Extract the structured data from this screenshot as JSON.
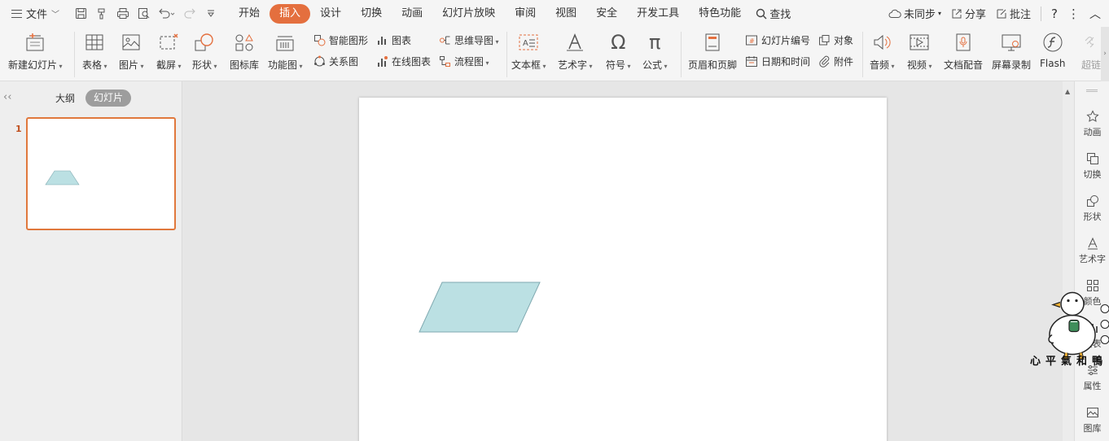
{
  "menubar": {
    "file_label": "文件",
    "tabs": [
      "开始",
      "插入",
      "设计",
      "切换",
      "动画",
      "幻灯片放映",
      "审阅",
      "视图",
      "安全",
      "开发工具",
      "特色功能"
    ],
    "active_tab": "插入",
    "search_label": "查找",
    "sync_label": "未同步",
    "share_label": "分享",
    "comment_label": "批注"
  },
  "ribbon": {
    "new_slide": "新建幻灯片",
    "table": "表格",
    "picture": "图片",
    "screenshot": "截屏",
    "shape": "形状",
    "icon_lib": "图标库",
    "function_chart": "功能图",
    "smart_shape": "智能图形",
    "relation": "关系图",
    "chart": "图表",
    "online_chart": "在线图表",
    "mindmap": "思维导图",
    "flowchart": "流程图",
    "textbox": "文本框",
    "wordart": "艺术字",
    "symbol": "符号",
    "formula": "公式",
    "header_footer": "页眉和页脚",
    "slide_number": "幻灯片编号",
    "datetime": "日期和时间",
    "object": "对象",
    "attachment": "附件",
    "audio": "音频",
    "video": "视频",
    "voiceover": "文档配音",
    "screen_record": "屏幕录制",
    "flash": "Flash",
    "hyperlink": "超链"
  },
  "leftpanel": {
    "outline_tab": "大纲",
    "slides_tab": "幻灯片",
    "slide_number": "1"
  },
  "rightpanel": {
    "items": [
      "动画",
      "切换",
      "形状",
      "艺术字",
      "颜色",
      "图表",
      "属性",
      "图库"
    ]
  },
  "slide": {
    "shape_fill": "#bbe0e3",
    "shape_stroke": "#7fa9b0"
  },
  "colors": {
    "accent": "#e46f3e",
    "thumb_border": "#e0783c"
  },
  "sticker": {
    "text": "心平氣和鴨"
  }
}
